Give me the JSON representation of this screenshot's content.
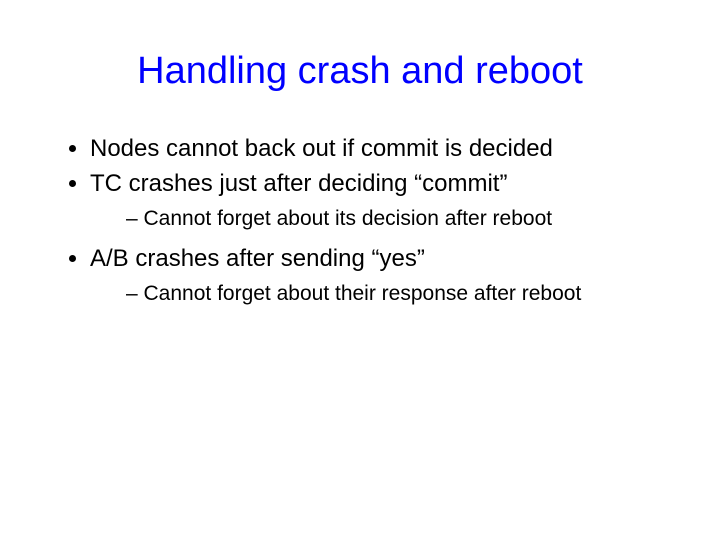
{
  "title": "Handling crash and reboot",
  "bullets": [
    {
      "text": "Nodes cannot back out if commit is decided",
      "sub": []
    },
    {
      "text": "TC crashes just after deciding “commit”",
      "sub": [
        "Cannot forget about its decision after reboot"
      ]
    },
    {
      "text": "A/B crashes after sending “yes”",
      "sub": [
        "Cannot forget about their response after reboot"
      ]
    }
  ]
}
